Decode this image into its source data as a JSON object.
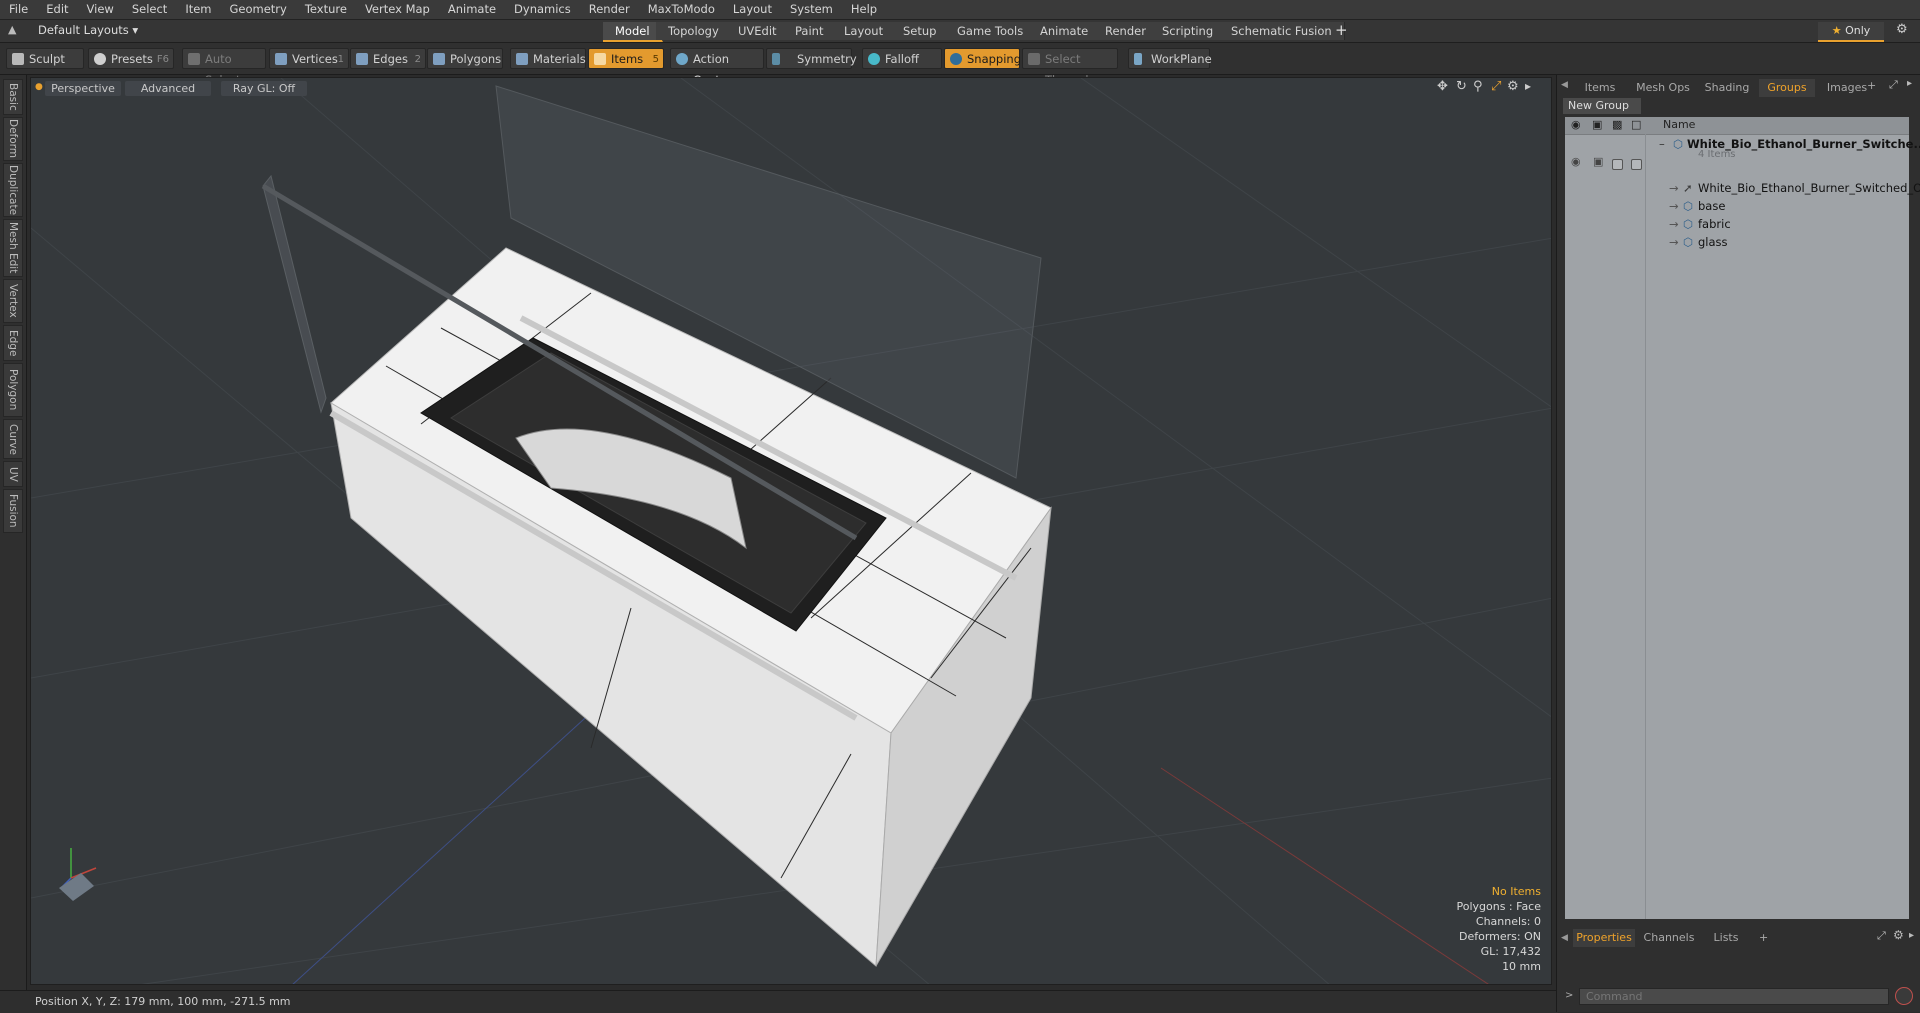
{
  "menubar": [
    "File",
    "Edit",
    "View",
    "Select",
    "Item",
    "Geometry",
    "Texture",
    "Vertex Map",
    "Animate",
    "Dynamics",
    "Render",
    "MaxToModo",
    "Layout",
    "System",
    "Help"
  ],
  "layouts": {
    "dropdown": "Default Layouts",
    "tabs": [
      "Model",
      "Topology",
      "UVEdit",
      "Paint",
      "Layout",
      "Setup",
      "Game Tools",
      "Animate",
      "Render",
      "Scripting",
      "Schematic Fusion"
    ],
    "active_tab": "Model",
    "plus": "+",
    "only_label": "Only"
  },
  "toolbar": {
    "sculpt": "Sculpt",
    "presets": "Presets",
    "presets_key": "F6",
    "auto_select": "Auto Select",
    "vertices": "Vertices",
    "vertices_count": "1",
    "edges": "Edges",
    "edges_count": "2",
    "polygons": "Polygons",
    "materials": "Materials",
    "items": "Items",
    "items_count": "5",
    "action_center": "Action Center",
    "symmetry": "Symmetry",
    "falloff": "Falloff",
    "snapping": "Snapping",
    "select_through": "Select Through",
    "workplane": "WorkPlane"
  },
  "left_tabs": [
    "Basic",
    "Deform",
    "Duplicate",
    "Mesh Edit",
    "Vertex",
    "Edge",
    "Polygon",
    "Curve",
    "UV",
    "Fusion"
  ],
  "viewport": {
    "view": "Perspective",
    "shading": "Advanced",
    "raygl": "Ray GL: Off",
    "info": {
      "selection": "No Items",
      "polygons": "Polygons : Face",
      "channels": "Channels: 0",
      "deformers": "Deformers: ON",
      "gl": "GL: 17,432",
      "unit": "10 mm"
    }
  },
  "status": {
    "position": "Position X, Y, Z:   179 mm, 100 mm, -271.5 mm"
  },
  "right_panel": {
    "tabs": [
      "Items",
      "Mesh Ops",
      "Shading",
      "Groups",
      "Images"
    ],
    "active_tab": "Groups",
    "new_group": "New Group",
    "column_name": "Name",
    "tree": {
      "root": "White_Bio_Ethanol_Burner_Switche...",
      "root_count": "4 Items",
      "children": [
        "White_Bio_Ethanol_Burner_Switched_Off",
        "base",
        "fabric",
        "glass"
      ]
    },
    "bottom_tabs": [
      "Properties",
      "Channels",
      "Lists"
    ],
    "active_bottom_tab": "Properties",
    "command_placeholder": "Command"
  },
  "colors": {
    "accent": "#e9a12f",
    "highlight_text": "#f0a32a"
  }
}
